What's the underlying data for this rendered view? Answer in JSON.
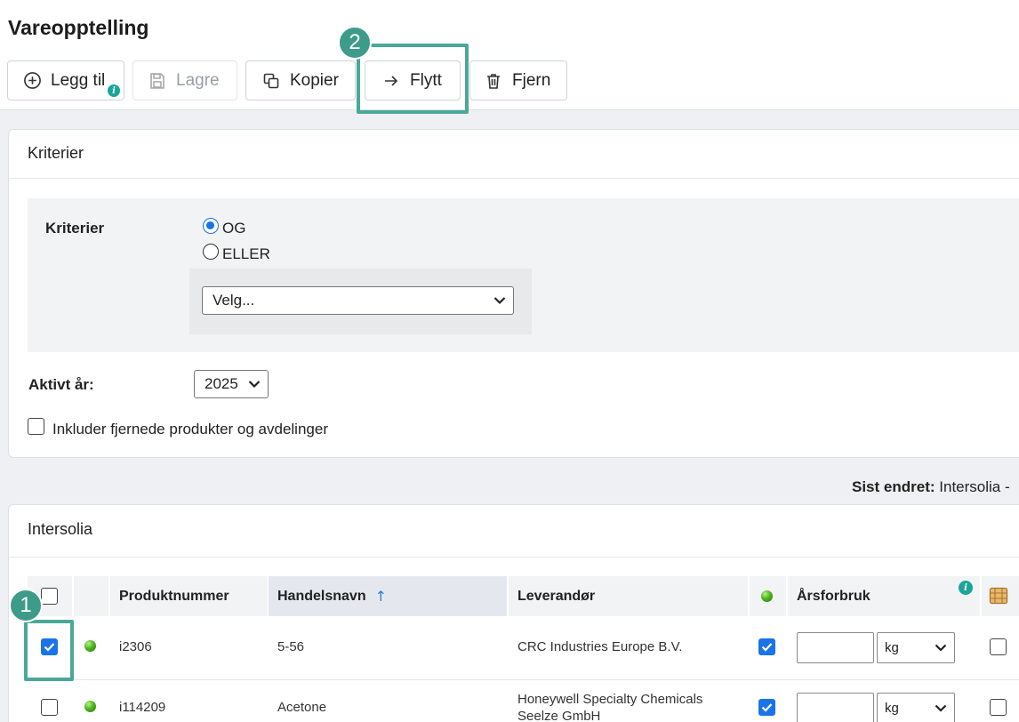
{
  "page": {
    "title": "Vareopptelling"
  },
  "toolbar": {
    "add_label": "Legg til",
    "add_info": "i",
    "save_label": "Lagre",
    "copy_label": "Kopier",
    "move_label": "Flytt",
    "remove_label": "Fjern"
  },
  "annotations": {
    "step1": "1",
    "step2": "2"
  },
  "criteria_panel": {
    "title": "Kriterier",
    "label": "Kriterier",
    "options": [
      {
        "label": "OG",
        "selected": true
      },
      {
        "label": "ELLER",
        "selected": false
      }
    ],
    "select_value": "Velg...",
    "active_year_label": "Aktivt år:",
    "active_year_value": "2025",
    "include_removed_label": "Inkluder fjernede produkter og avdelinger",
    "include_removed_checked": false
  },
  "last_changed": {
    "label": "Sist endret:",
    "value": "Intersolia -"
  },
  "table_panel": {
    "title": "Intersolia",
    "info": "i",
    "headers": {
      "product_number": "Produktnummer",
      "trade_name": "Handelsnavn",
      "sort_arrow": "↑",
      "supplier": "Leverandør",
      "annual_usage": "Årsforbruk"
    },
    "rows": [
      {
        "selected": true,
        "status_color": "#3db01a",
        "product_number": "i2306",
        "trade_name": "5-56",
        "supplier_line1": "CRC Industries Europe B.V.",
        "supplier_line2": "",
        "active": true,
        "usage": "",
        "unit": "kg",
        "flag": false
      },
      {
        "selected": false,
        "status_color": "#3db01a",
        "product_number": "i114209",
        "trade_name": "Acetone",
        "supplier_line1": "Honeywell Specialty Chemicals",
        "supplier_line2": "Seelze GmbH",
        "active": true,
        "usage": "",
        "unit": "kg",
        "flag": false
      }
    ]
  },
  "colors": {
    "accent": "#1a73e8",
    "highlight": "#4aa897",
    "info_badge": "#1aa59a"
  }
}
